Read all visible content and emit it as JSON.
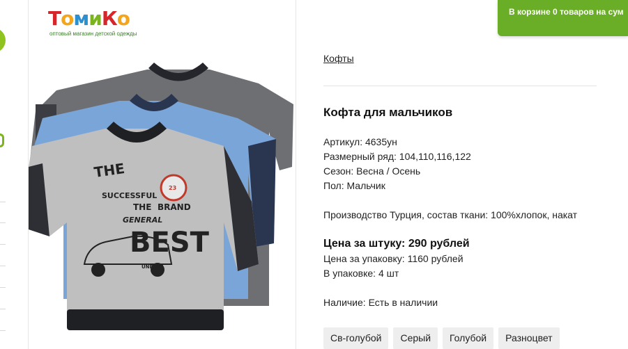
{
  "logo": {
    "text": "ТомиКо",
    "tagline": "оптовый магазин детской одежды"
  },
  "cart": {
    "prefix": "В корзине ",
    "count": "0 товаров",
    "suffix": " на сум"
  },
  "breadcrumb": "Кофты",
  "product": {
    "title": "Кофта для мальчиков",
    "article": "Артикул: 4635ун",
    "sizes": "Размерный ряд: 104,110,116,122",
    "season": "Сезон: Весна / Осень",
    "gender": "Пол: Мальчик",
    "production": "Производство Турция, состав ткани: 100%хлопок, накат",
    "price_per_item": "Цена за штуку: 290 рублей",
    "price_per_pack": "Цена за упаковку: 1160 рублей",
    "in_pack": "В упаковке: 4 шт",
    "availability": "Наличие: Есть в наличии"
  },
  "colors": [
    "Св-голубой",
    "Серый",
    "Голубой",
    "Разноцвет"
  ],
  "print_text": {
    "brand_top": "THE",
    "succes": "SUCCESSFUL",
    "the2": "THE",
    "brand": "BRAND",
    "general": "GENERAL",
    "best": "BEST",
    "unruly": "UNRULY",
    "badge": "23"
  },
  "palette": {
    "accent_green": "#6aae27",
    "sweater_grey": "#6e6f73",
    "sweater_light_blue": "#7aa5d9",
    "sweater_navy": "#2a3550",
    "sweater_heather": "#bfbfbf"
  }
}
